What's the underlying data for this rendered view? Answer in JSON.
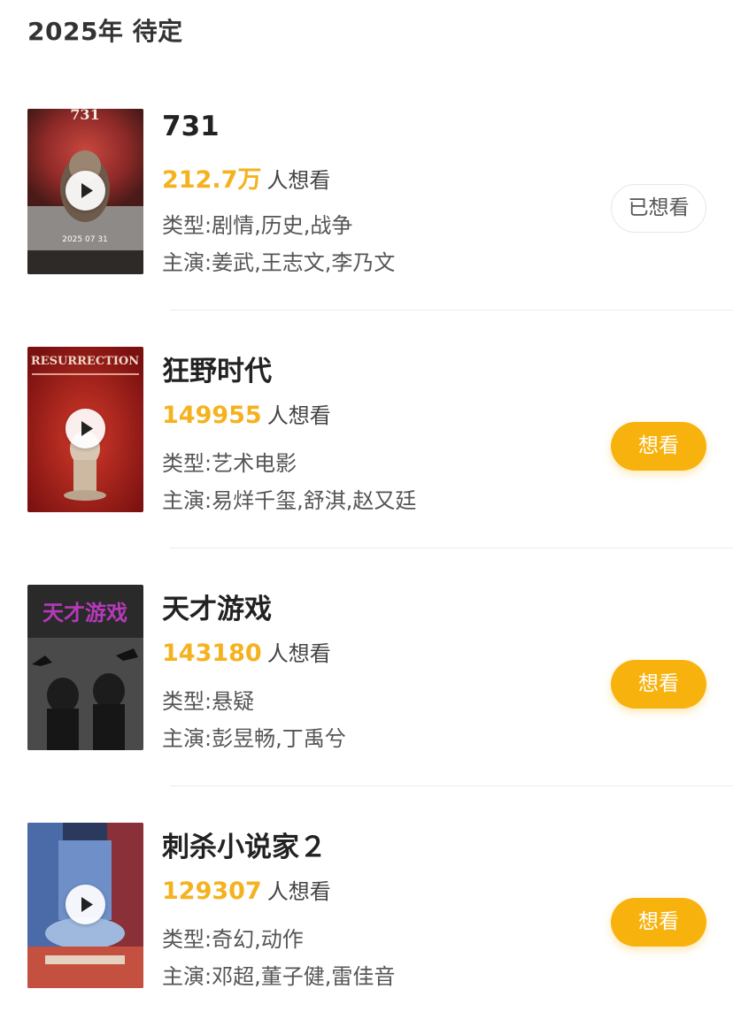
{
  "section": {
    "title": "2025年 待定"
  },
  "movies": [
    {
      "title": "731",
      "wish_count": "212.7万",
      "wish_suffix": "人想看",
      "genre": "类型:剧情,历史,战争",
      "cast": "主演:姜武,王志文,李乃文",
      "button": "已想看",
      "button_state": "done"
    },
    {
      "title": "狂野时代",
      "wish_count": "149955",
      "wish_suffix": "人想看",
      "genre": "类型:艺术电影",
      "cast": "主演:易烊千玺,舒淇,赵又廷",
      "button": "想看",
      "button_state": "active"
    },
    {
      "title": "天才游戏",
      "wish_count": "143180",
      "wish_suffix": "人想看",
      "genre": "类型:悬疑",
      "cast": "主演:彭昱畅,丁禹兮",
      "button": "想看",
      "button_state": "active"
    },
    {
      "title": "刺杀小说家２",
      "wish_count": "129307",
      "wish_suffix": "人想看",
      "genre": "类型:奇幻,动作",
      "cast": "主演:邓超,董子健,雷佳音",
      "button": "想看",
      "button_state": "active"
    }
  ],
  "colors": {
    "accent": "#f8b20e",
    "wish_count": "#f5b21f"
  },
  "icons": {
    "play": "play-icon"
  }
}
